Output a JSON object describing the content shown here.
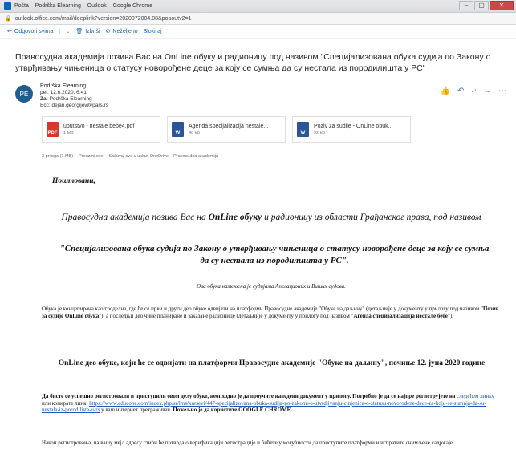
{
  "window": {
    "title": "Pošta – Podrška Elearning – Outlook – Google Chrome",
    "url": "outlook.office.com/mail/deeplink?version=2020072004.08&popoutv2=1"
  },
  "toolbar": {
    "reply_all": "Odgovori svima",
    "delete": "Izbriši",
    "junk": "Neželjeno",
    "block": "Blokiraj"
  },
  "message": {
    "subject": "Правосудна академија позива Вас на OnLine обуку и радионицу под називом \"Специјализована обука судија по Закону о утврђивању чињеница о статусу новорођене деце за коју се сумња да су нестала из породилишта у РС\"",
    "sender_name": "Podrška Elearning",
    "date": "pet. 12.6.2020. 6:41",
    "to_label": "Za:",
    "to_value": "Podrška Elearning",
    "bcc_label": "Bcc:",
    "bcc_value": "dejan.georgijev@pars.rs",
    "avatar_initials": "PE"
  },
  "attachments": [
    {
      "name": "uputstvo - nestale bebe4.pdf",
      "size": "1 MB",
      "type": "pdf"
    },
    {
      "name": "Agenda specijalizacija nestale...",
      "size": "40 kB",
      "type": "doc"
    },
    {
      "name": "Poziv za sudije - OnLine obuk...",
      "size": "92 kB",
      "type": "doc"
    }
  ],
  "attach_summary": {
    "count": "3 priloga (1 MB)",
    "download_all": "Preuzmi sve",
    "save_onedrive": "Sačuvaj sve u usluzi OneDrive – Pravosudna akademija"
  },
  "body": {
    "greeting": "Поштовани,",
    "intro_pre": "Правосудна академија позива Вас на ",
    "intro_bold": "OnLine обуку",
    "intro_post": " и радионицу из области Грађанског права, под називом",
    "course_title": "\"Специјализована обука судија по Закону о утврђивању чињеница о статусу новорођене деце за коју се сумња да су нестала из породилишта у РС\".",
    "intended": "Ова обука намењена је судијама Апелационих и Виших судова.",
    "para1_a": "Обука је концепирана као троделна, где ће се први и други део обуке одвијати на платформи Правосудне академије \"Обуке на даљину\" (детаљније у документу у прилогу под називом \"",
    "para1_b": "Позив за судије OnLine обука",
    "para1_c": "\"), а последњи део чине планиране и заказане радионице (детаљније у документу у прилогу под називом \"",
    "para1_d": "Агенда специјализација нестале бебе",
    "para1_e": "\").",
    "online_heading": "OnLine део обуке, који ће се одвијати на платформи Правосудне академије \"Обуке на даљину\", почиње 12. јуна 2020 године",
    "para2_a": "Да бисте се успешно регистровали и приступили овом делу обуке, неопходно је да проучите наведени документ у прилогу. Потребно је да се најпре региструјете на ",
    "para2_link1": "следећем линку",
    "para2_b": " или копирате линк: ",
    "para2_link2": "https://www.educone.com/index.php/sr/lms/kursevi/447-specijalizovana-obuka-sudija-po-zakonu-o-utvrdjivanju-cinjenica-o-statusu-novorodene-dece-za-koju-se-sumnja-da-su-nestala-iz-porodilista-u-rs",
    "para2_c": " у ваш интернет претраживач. ",
    "para2_d": "Пожељно је да користите GOOGLE CHROME.",
    "para3": "Након регистровања, на вашу мејл адресу стићи ће потврда о верификацији регистрације и бићете у могућности да приступите платформи и испратите снимљене садржаје."
  }
}
